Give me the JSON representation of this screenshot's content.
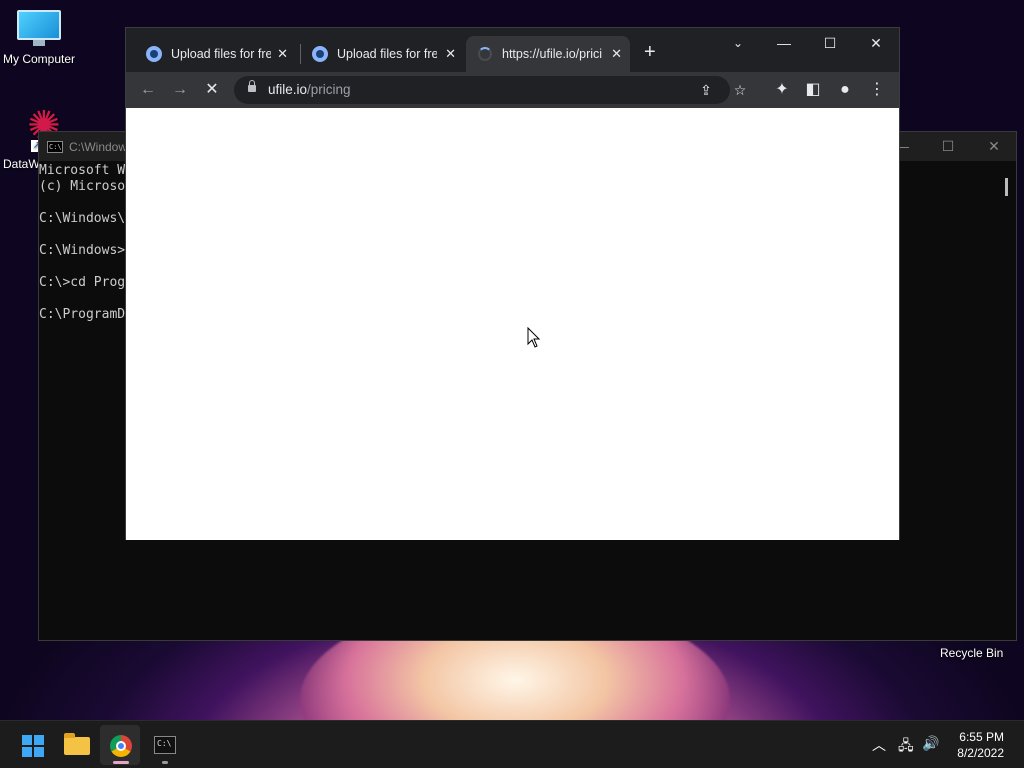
{
  "desktop": {
    "icons": [
      {
        "label": "My Computer"
      },
      {
        "label": "DataW"
      }
    ],
    "recycle_bin": "Recycle Bin"
  },
  "cmd": {
    "title": "C:\\Window",
    "icon_text": "C:\\",
    "lines": [
      "Microsoft W",
      "(c) Microso",
      "",
      "C:\\Windows\\",
      "",
      "C:\\Windows>",
      "",
      "C:\\>cd Prog",
      "",
      "C:\\ProgramD"
    ]
  },
  "browser": {
    "tabs": [
      {
        "title": "Upload files for free",
        "state": "loaded"
      },
      {
        "title": "Upload files for free",
        "state": "loaded"
      },
      {
        "title": "https://ufile.io/pricing",
        "state": "loading"
      }
    ],
    "new_tab": "+",
    "address": {
      "host": "ufile.io",
      "path": "/pricing"
    }
  },
  "taskbar": {
    "apps": [
      "start",
      "file-explorer",
      "chrome",
      "terminal"
    ],
    "clock": {
      "time": "6:55 PM",
      "date": "8/2/2022"
    },
    "colors": {
      "chrome_indicator": "#e3a6c4",
      "terminal_indicator": "#9a9a9a"
    }
  }
}
